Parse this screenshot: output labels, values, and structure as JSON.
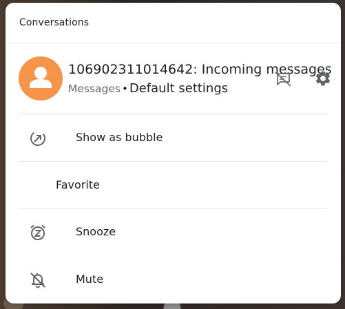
{
  "header": {
    "title": "Conversations"
  },
  "conversation": {
    "title": "106902311014642: Incoming messages",
    "app_name": "Messages",
    "separator": "•",
    "setting": "Default settings",
    "avatar_color": "#f5944a",
    "avatar_icon": "person-icon",
    "bubble_off_icon": "bubble-disabled-icon",
    "settings_icon": "gear-icon"
  },
  "options": [
    {
      "label": "Show as bubble",
      "icon": "show-bubble-icon"
    },
    {
      "label": "Favorite",
      "icon": ""
    },
    {
      "label": "Snooze",
      "icon": "snooze-alarm-icon"
    },
    {
      "label": "Mute",
      "icon": "mute-bell-icon"
    }
  ]
}
